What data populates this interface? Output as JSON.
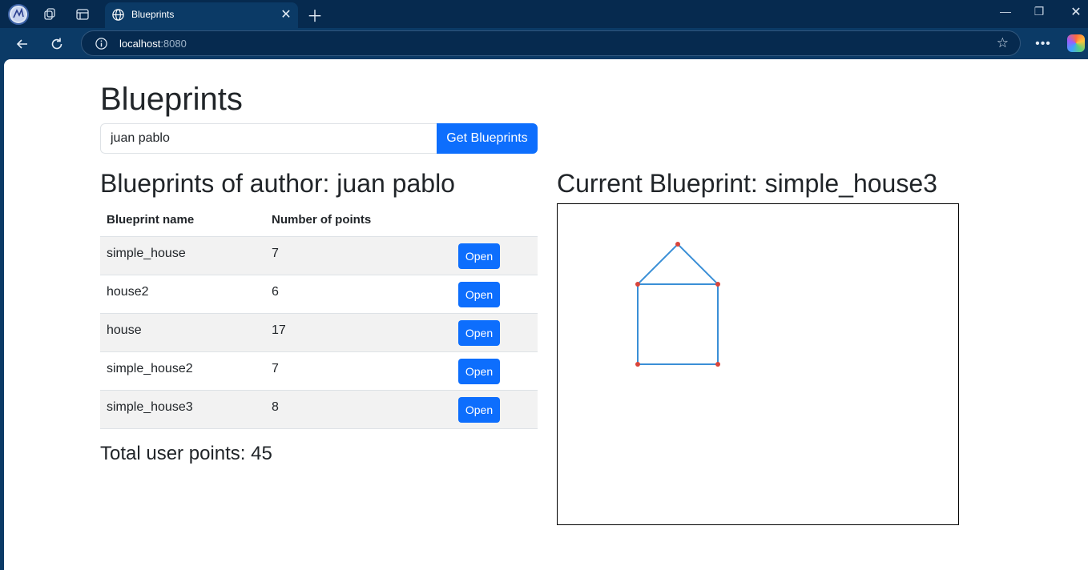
{
  "browser": {
    "tab_title": "Blueprints",
    "address_host": "localhost",
    "address_port": ":8080"
  },
  "page": {
    "title": "Blueprints",
    "author_input_value": "juan pablo",
    "get_button_label": "Get Blueprints",
    "author_heading": "Blueprints of author: juan pablo",
    "current_heading": "Current Blueprint: simple_house3",
    "table": {
      "headers": [
        "Blueprint name",
        "Number of points",
        ""
      ],
      "rows": [
        {
          "name": "simple_house",
          "points": "7",
          "action": "Open"
        },
        {
          "name": "house2",
          "points": "6",
          "action": "Open"
        },
        {
          "name": "house",
          "points": "17",
          "action": "Open"
        },
        {
          "name": "simple_house2",
          "points": "7",
          "action": "Open"
        },
        {
          "name": "simple_house3",
          "points": "8",
          "action": "Open"
        }
      ]
    },
    "total_points": "Total user points: 45"
  },
  "colors": {
    "primary": "#0d6efd",
    "line": "#3a8fd6",
    "point": "#d9453b"
  },
  "icons": [
    "profile-avatar-icon",
    "workspaces-icon",
    "tab-actions-icon",
    "globe-icon",
    "close-icon",
    "new-tab-icon",
    "minimize-icon",
    "restore-icon",
    "window-close-icon",
    "back-icon",
    "refresh-icon",
    "info-icon",
    "favorite-star-icon",
    "more-icon",
    "copilot-icon"
  ]
}
